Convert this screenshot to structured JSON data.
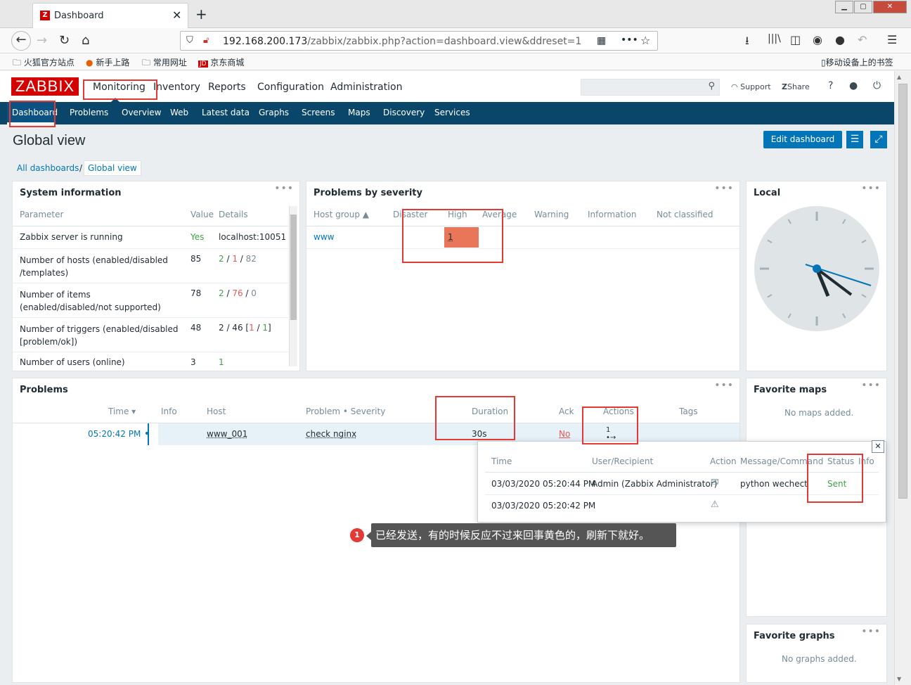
{
  "browser": {
    "tab_title": "Dashboard",
    "url_host": "192.168.200.173",
    "url_path": "/zabbix/zabbix.php?action=dashboard.view&ddreset=1",
    "bookmarks": [
      "火狐官方站点",
      "新手上路",
      "常用网址",
      "京东商城"
    ],
    "mobile_bookmarks": "移动设备上的书签"
  },
  "header": {
    "logo": "ZABBIX",
    "menu": [
      "Monitoring",
      "Inventory",
      "Reports",
      "Configuration",
      "Administration"
    ],
    "support": "Support",
    "share": "Share",
    "help": "?"
  },
  "submenu": [
    "Dashboard",
    "Problems",
    "Overview",
    "Web",
    "Latest data",
    "Graphs",
    "Screens",
    "Maps",
    "Discovery",
    "Services"
  ],
  "page": {
    "title": "Global view",
    "edit_button": "Edit dashboard",
    "breadcrumb": [
      "All dashboards",
      "Global view"
    ],
    "sep": "/"
  },
  "sysinfo": {
    "title": "System information",
    "headers": [
      "Parameter",
      "Value",
      "Details"
    ],
    "rows": [
      {
        "param": "Zabbix server is running",
        "value": "Yes",
        "details": "localhost:10051"
      },
      {
        "param": "Number of hosts (enabled/disabled /templates)",
        "value": "85",
        "d1": "2",
        "d2": "1",
        "d3": "82"
      },
      {
        "param": "Number of items (enabled/disabled/not supported)",
        "value": "78",
        "d1": "2",
        "d2": "76",
        "d3": "0"
      },
      {
        "param": "Number of triggers (enabled/disabled [problem/ok])",
        "value": "48",
        "d1": "2 / 46 [",
        "d2": "1",
        "d3": "1"
      },
      {
        "param": "Number of users (online)",
        "value": "3",
        "d1": "1"
      }
    ]
  },
  "severity": {
    "title": "Problems by severity",
    "headers": [
      "Host group ▲",
      "Disaster",
      "High",
      "Average",
      "Warning",
      "Information",
      "Not classified"
    ],
    "row": {
      "group": "www",
      "high": "1"
    }
  },
  "local": {
    "title": "Local"
  },
  "problems": {
    "title": "Problems",
    "headers": [
      "Time ▾",
      "Info",
      "Host",
      "Problem • Severity",
      "Duration",
      "Ack",
      "Actions",
      "Tags"
    ],
    "row": {
      "time": "05:20:42 PM",
      "host": "www_001",
      "problem": "check nginx",
      "duration": "30s",
      "ack": "No",
      "actions": "1"
    }
  },
  "popup": {
    "headers": [
      "Time",
      "User/Recipient",
      "Action",
      "Message/Command",
      "Status",
      "Info"
    ],
    "rows": [
      {
        "time": "03/03/2020 05:20:44 PM",
        "user": "Admin (Zabbix Administrator)",
        "message": "python wechect",
        "status": "Sent"
      },
      {
        "time": "03/03/2020 05:20:42 PM"
      }
    ]
  },
  "fav_maps": {
    "title": "Favorite maps",
    "empty": "No maps added."
  },
  "fav_graphs": {
    "title": "Favorite graphs",
    "empty": "No graphs added."
  },
  "annotation": {
    "num": "1",
    "text": "已经发送，有的时候反应不过来回事黄色的，刷新下就好。"
  },
  "colors": {
    "brand": "#d40000",
    "nav": "#0a466a",
    "accent": "#0275b8",
    "high": "#e97659",
    "annot": "#e53935"
  }
}
